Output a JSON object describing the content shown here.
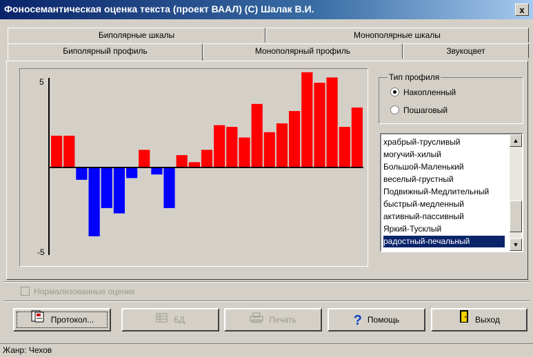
{
  "window": {
    "title": "Фоносемантическая оценка текста (проект ВААЛ) (С) Шалак В.И.",
    "close_glyph": "x"
  },
  "tabs_top": [
    {
      "label": "Биполярные шкалы"
    },
    {
      "label": "Монополярные шкалы"
    }
  ],
  "tabs_bottom": [
    {
      "label": "Биполярный профиль",
      "active": true
    },
    {
      "label": "Монополярный профиль",
      "active": false
    },
    {
      "label": "Звукоцвет",
      "active": false
    }
  ],
  "chart_data": {
    "type": "bar",
    "ylim": [
      -5,
      5
    ],
    "ytick_labels": [
      "5",
      "-5"
    ],
    "values": [
      1.8,
      1.8,
      -0.7,
      -3.9,
      -2.3,
      -2.6,
      -0.6,
      1.0,
      -0.4,
      -2.3,
      0.7,
      0.3,
      1.0,
      2.4,
      2.3,
      1.7,
      3.6,
      2.0,
      2.5,
      3.2,
      5.4,
      4.8,
      5.1,
      2.3,
      3.4
    ],
    "positive_color": "#ff0000",
    "negative_color": "#0000ff"
  },
  "profile_type": {
    "legend": "Тип профиля",
    "options": [
      {
        "label": "Накопленный",
        "selected": true
      },
      {
        "label": "Пошаговый",
        "selected": false
      }
    ]
  },
  "scales_list": {
    "items": [
      "храбрый-трусливый",
      "могучий-хилый",
      "Большой-Маленький",
      "веселый-грустный",
      "Подвижный-Медлительный",
      "быстрый-медленный",
      "активный-пассивный",
      "Яркий-Тусклый",
      "радостный-печальный"
    ],
    "selected_index": 8,
    "up_glyph": "▲",
    "down_glyph": "▼"
  },
  "normalize_label": "Нормализованные оценки",
  "buttons": {
    "protocol": "Протокол...",
    "db": "БД",
    "print": "Печать",
    "help": "Помощь",
    "exit": "Выход"
  },
  "icons": {
    "protocol": "document-icon",
    "db": "database-icon",
    "print": "printer-icon",
    "help": "question-icon",
    "exit": "door-icon"
  },
  "status": {
    "text": "Жанр: Чехов"
  }
}
